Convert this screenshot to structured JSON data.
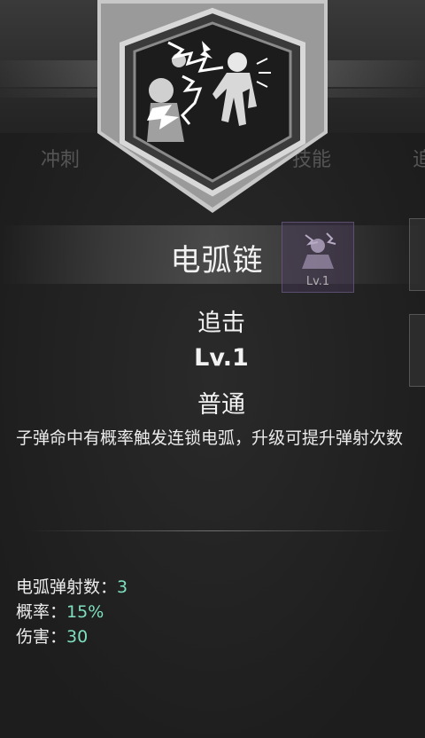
{
  "background_tabs": [
    "冲刺",
    "技能",
    "追"
  ],
  "skill": {
    "name": "电弧链",
    "type": "追击",
    "level": "Lv.1",
    "rarity": "普通",
    "description": "子弹命中有概率触发连锁电弧，升级可提升弹射次数"
  },
  "thumbnail": {
    "level": "Lv.1"
  },
  "stats": [
    {
      "label": "电弧弹射数：",
      "value": "3"
    },
    {
      "label": "概率：",
      "value": "15%"
    },
    {
      "label": "伤害：",
      "value": "30"
    }
  ],
  "colors": {
    "stat_value": "#7ee0c0",
    "thumb_border": "#6a5a80"
  },
  "icons": {
    "badge": "electric-zombie-badge-icon",
    "thumbnail": "electric-zombie-thumbnail-icon"
  }
}
